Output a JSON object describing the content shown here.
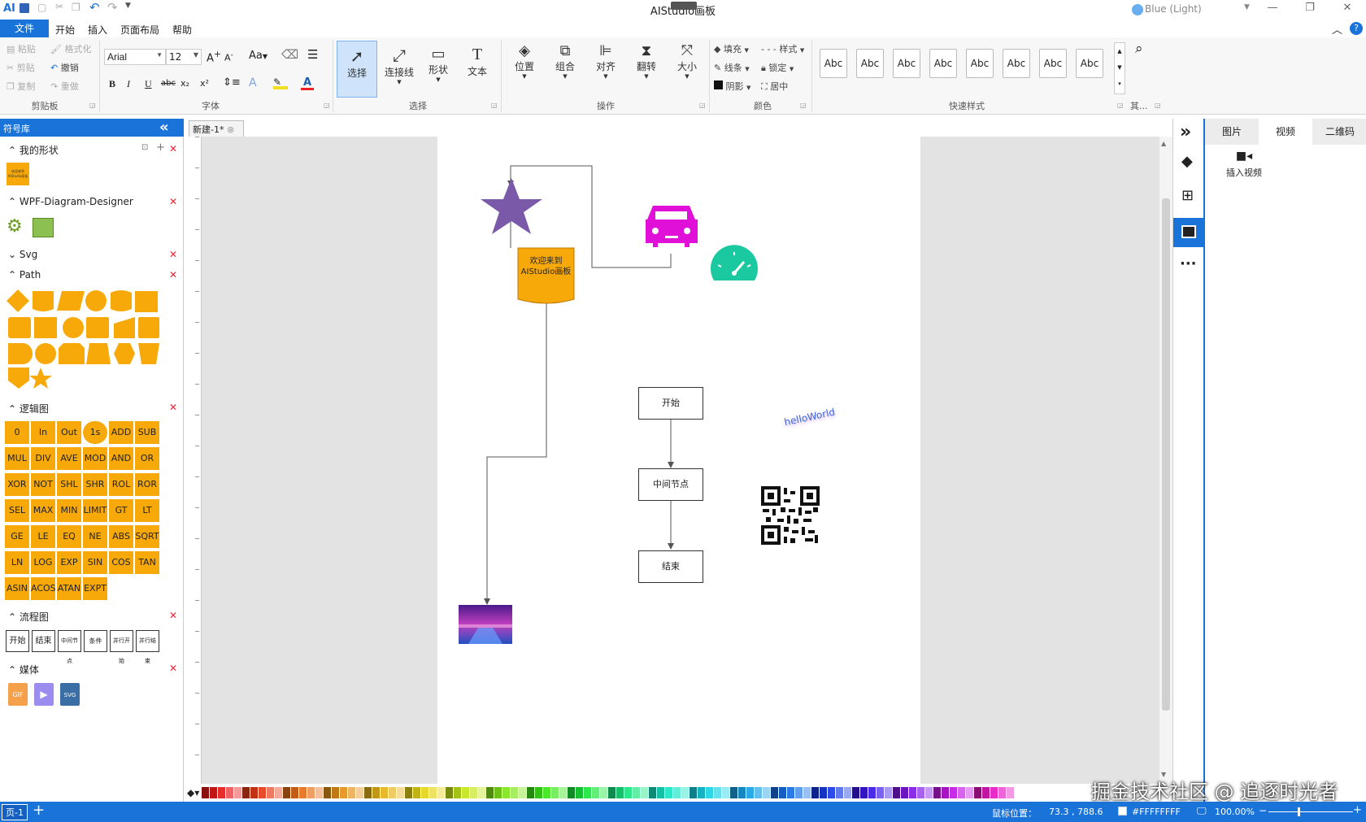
{
  "app": {
    "title": "AIStudio画板",
    "theme": "Blue (Light)"
  },
  "menu": {
    "file": "文件",
    "items": [
      "开始",
      "插入",
      "页面布局",
      "帮助"
    ]
  },
  "ribbon": {
    "clipboard": {
      "paste": "粘贴",
      "format_painter": "格式化",
      "cut": "剪贴",
      "undo": "撤销",
      "copy": "复制",
      "redo": "重做",
      "group": "剪贴板"
    },
    "font": {
      "name": "Arial",
      "size": "12",
      "aa": "Aa",
      "group": "字体",
      "bold": "B",
      "italic": "I",
      "underline": "U",
      "strike": "abc",
      "sub": "x₂",
      "sup": "x²"
    },
    "select": {
      "select": "选择",
      "connector": "连接线",
      "shape": "形状",
      "text": "文本",
      "group": "选择"
    },
    "operate": {
      "position": "位置",
      "combine": "组合",
      "align": "对齐",
      "flip": "翻转",
      "size": "大小",
      "group": "操作"
    },
    "color": {
      "fill": "填充",
      "line": "线条",
      "shadow": "阴影",
      "style": "样式",
      "lock": "锁定",
      "center": "居中",
      "group": "颜色"
    },
    "quick": {
      "items": [
        "Abc",
        "Abc",
        "Abc",
        "Abc",
        "Abc",
        "Abc",
        "Abc",
        "Abc"
      ],
      "group": "快速样式",
      "other": "其..."
    }
  },
  "left": {
    "title": "符号库",
    "sections": {
      "my": "我的形状",
      "wpf": "WPF-Diagram-Designer",
      "svg": "Svg",
      "path": "Path",
      "logic": "逻辑图",
      "flow": "流程图",
      "media": "媒体"
    },
    "my_thumb": "欢迎来到AIStudio画板",
    "logic": [
      "0",
      "In",
      "Out",
      "1s",
      "ADD",
      "SUB",
      "MUL",
      "DIV",
      "AVE",
      "MOD",
      "AND",
      "OR",
      "XOR",
      "NOT",
      "SHL",
      "SHR",
      "ROL",
      "ROR",
      "SEL",
      "MAX",
      "MIN",
      "LIMIT",
      "GT",
      "LT",
      "GE",
      "LE",
      "EQ",
      "NE",
      "ABS",
      "SQRT",
      "LN",
      "LOG",
      "EXP",
      "SIN",
      "COS",
      "TAN",
      "ASIN",
      "ACOS",
      "ATAN",
      "EXPT"
    ],
    "flow": [
      "开始",
      "结束",
      "中间节点",
      "条件",
      "并行开始",
      "并行结束"
    ],
    "media": [
      "GIF",
      "",
      "SVG"
    ]
  },
  "tabs": {
    "doc": "新建-1*"
  },
  "canvas": {
    "welcome": "欢迎来到AIStudio画板",
    "start": "开始",
    "middle": "中间节点",
    "end": "结束",
    "hello": "helloWorld"
  },
  "right": {
    "tabs": [
      "图片",
      "视频",
      "二维码"
    ],
    "insert_video": "插入视频"
  },
  "status": {
    "page": "页-1",
    "pos_label": "鼠标位置：",
    "pos_value": "73.3 , 788.6",
    "color": "#FFFFFFFF",
    "zoom": "100.00%"
  },
  "watermark": "掘金技术社区 @ 追逐时光者"
}
